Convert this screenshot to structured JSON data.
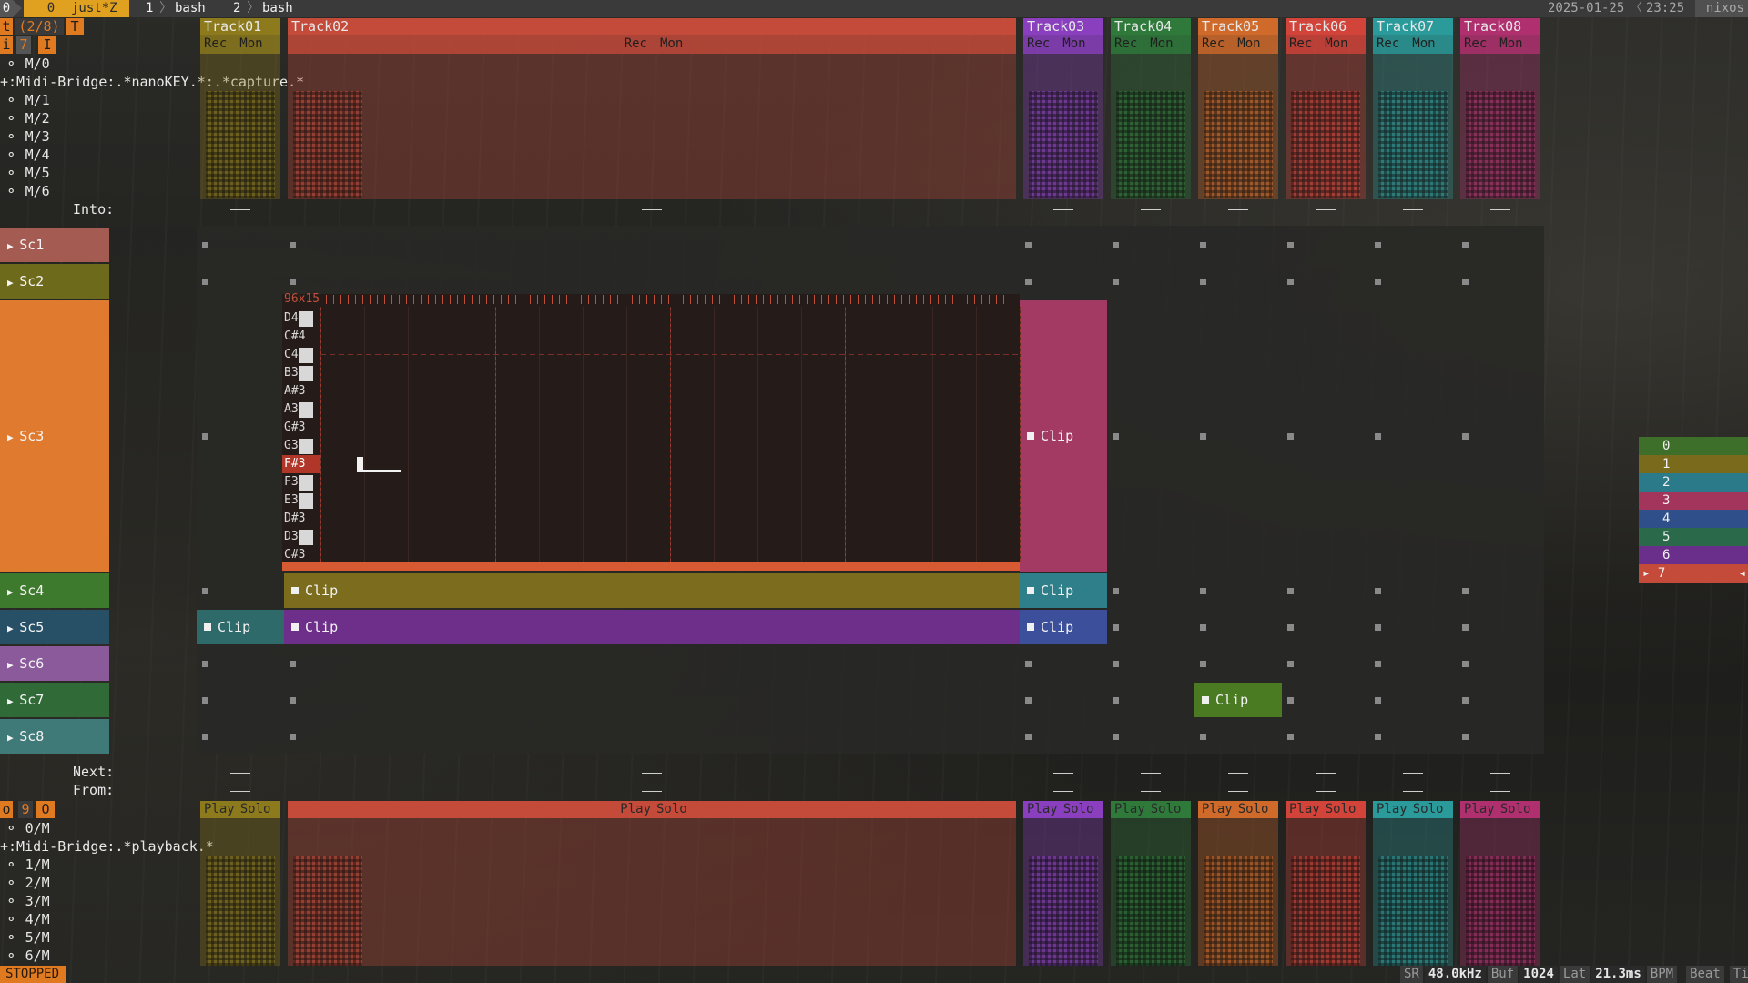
{
  "tmux": {
    "left_tabs": [
      "0",
      "0",
      "just*Z",
      "1",
      "bash",
      "2",
      "bash"
    ],
    "date": "2025-01-25",
    "time": "23:25",
    "host": "nixos"
  },
  "top_indicators": {
    "row1": [
      "t",
      "(2/8)",
      "T"
    ],
    "row2": [
      "i",
      "7",
      "I"
    ]
  },
  "inputs": {
    "ports": [
      "M/0",
      "+:Midi-Bridge:.*nanoKEY.*:.*capture.*",
      "M/1",
      "M/2",
      "M/3",
      "M/4",
      "M/5",
      "M/6"
    ],
    "into_label": "Into:"
  },
  "outputs": {
    "indicators": [
      "o",
      "9",
      "O"
    ],
    "ports": [
      "0/M",
      "+:Midi-Bridge:.*playback.*",
      "1/M",
      "2/M",
      "3/M",
      "4/M",
      "5/M",
      "6/M"
    ],
    "next_label": "Next:",
    "from_label": "From:"
  },
  "tracks": [
    {
      "name": "Track01",
      "rec": "Rec",
      "mon": "Mon",
      "play": "Play",
      "solo": "Solo",
      "color": "#8c7a1d"
    },
    {
      "name": "Track02",
      "rec": "Rec",
      "mon": "Mon",
      "play": "Play",
      "solo": "Solo",
      "color": "#c44a3a"
    },
    {
      "name": "Track03",
      "rec": "Rec",
      "mon": "Mon",
      "play": "Play",
      "solo": "Solo",
      "color": "#8a3fbf"
    },
    {
      "name": "Track04",
      "rec": "Rec",
      "mon": "Mon",
      "play": "Play",
      "solo": "Solo",
      "color": "#2f7a3b"
    },
    {
      "name": "Track05",
      "rec": "Rec",
      "mon": "Mon",
      "play": "Play",
      "solo": "Solo",
      "color": "#d06a2a"
    },
    {
      "name": "Track06",
      "rec": "Rec",
      "mon": "Mon",
      "play": "Play",
      "solo": "Solo",
      "color": "#d2433a"
    },
    {
      "name": "Track07",
      "rec": "Rec",
      "mon": "Mon",
      "play": "Play",
      "solo": "Solo",
      "color": "#2a9a9a"
    },
    {
      "name": "Track08",
      "rec": "Rec",
      "mon": "Mon",
      "play": "Play",
      "solo": "Solo",
      "color": "#b0306f"
    }
  ],
  "scenes": [
    {
      "name": "Sc1",
      "color": "#a45b52"
    },
    {
      "name": "Sc2",
      "color": "#6e6a1c"
    },
    {
      "name": "Sc3",
      "color": "#e07a2e"
    },
    {
      "name": "Sc4",
      "color": "#3e7a2e"
    },
    {
      "name": "Sc5",
      "color": "#274f66"
    },
    {
      "name": "Sc6",
      "color": "#8a5a9a"
    },
    {
      "name": "Sc7",
      "color": "#2f6a37"
    },
    {
      "name": "Sc8",
      "color": "#3f7a78"
    }
  ],
  "clips": [
    {
      "scene": "Sc3",
      "track": "Track03",
      "label": "Clip",
      "color": "#a33a63"
    },
    {
      "scene": "Sc4",
      "track": "Track02",
      "label": "Clip",
      "color": "#7c6d1e"
    },
    {
      "scene": "Sc4",
      "track": "Track03",
      "label": "Clip",
      "color": "#2f7f8a"
    },
    {
      "scene": "Sc5",
      "track": "Track01",
      "label": "Clip",
      "color": "#2f6a6a"
    },
    {
      "scene": "Sc5",
      "track": "Track02",
      "label": "Clip",
      "color": "#6e2f8a"
    },
    {
      "scene": "Sc5",
      "track": "Track03",
      "label": "Clip",
      "color": "#3b4f9a"
    },
    {
      "scene": "Sc7",
      "track": "Track05",
      "label": "Clip",
      "color": "#4a7a22"
    }
  ],
  "editor": {
    "size_label": "96x15",
    "keys": [
      "D4",
      "C#4",
      "C4",
      "B3",
      "A#3",
      "A3",
      "G#3",
      "G3",
      "F#3",
      "F3",
      "E3",
      "D#3",
      "D3",
      "C#3"
    ],
    "selected_key": "F#3"
  },
  "selector": {
    "items": [
      "0",
      "1",
      "2",
      "3",
      "4",
      "5",
      "6",
      "7"
    ],
    "colors": [
      "#3e6f2a",
      "#7a6a1c",
      "#2a7a8a",
      "#a3345c",
      "#2f4f8a",
      "#2a6a4a",
      "#6a2f8a",
      "#c44a3a"
    ],
    "selected": "7"
  },
  "status": {
    "state": "STOPPED",
    "sr_label": "SR",
    "sr": "48.0kHz",
    "buf_label": "Buf",
    "buf": "1024",
    "lat_label": "Lat",
    "lat": "21.3ms",
    "bpm_label": "BPM",
    "beat_label": "Beat",
    "time_label": "Time"
  }
}
